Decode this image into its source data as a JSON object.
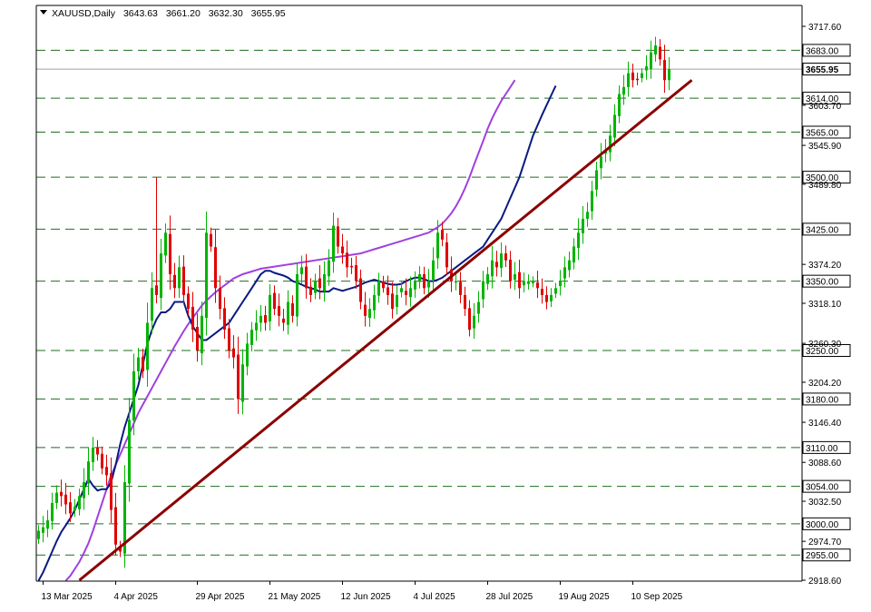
{
  "header": {
    "symbol": "XAUUSD,Daily",
    "open": "3643.63",
    "high": "3661.20",
    "low": "3632.30",
    "close": "3655.95"
  },
  "colors": {
    "bull": "#00b400",
    "bear": "#e00000",
    "level_line": "#1e6e1e",
    "trendline": "#8b0000",
    "ma_fast": "#0a1a80",
    "ma_slow": "#a040e0",
    "current_price_line": "#a0a0a0"
  },
  "chart_data": {
    "type": "candlestick",
    "instrument": "XAUUSD",
    "timeframe": "Daily",
    "ylim": [
      2918.6,
      3717.6
    ],
    "y_ticks": [
      "3717.60",
      "3603.70",
      "3545.90",
      "3489.80",
      "3374.20",
      "3318.10",
      "3260.30",
      "3204.20",
      "3146.40",
      "3088.60",
      "3032.50",
      "2974.70",
      "2918.60"
    ],
    "x_ticks": [
      "13 Mar 2025",
      "4 Apr 2025",
      "29 Apr 2025",
      "21 May 2025",
      "12 Jun 2025",
      "4 Jul 2025",
      "28 Jul 2025",
      "19 Aug 2025",
      "10 Sep 2025"
    ],
    "x_tick_bar_index": [
      1,
      17,
      35,
      51,
      67,
      83,
      99,
      115,
      131
    ],
    "bar_count": 140,
    "horizontal_levels": [
      "3683.00",
      "3614.00",
      "3565.00",
      "3500.00",
      "3425.00",
      "3350.00",
      "3250.00",
      "3180.00",
      "3110.00",
      "3054.00",
      "3000.00",
      "2955.00"
    ],
    "current_price": "3655.95",
    "closes": [
      2990,
      2995,
      3005,
      3030,
      3045,
      3040,
      3028,
      3015,
      3025,
      3040,
      3060,
      3090,
      3110,
      3100,
      3080,
      3070,
      3020,
      2970,
      2960,
      3060,
      3150,
      3220,
      3240,
      3220,
      3290,
      3340,
      3330,
      3390,
      3420,
      3360,
      3340,
      3370,
      3330,
      3310,
      3280,
      3250,
      3300,
      3420,
      3400,
      3340,
      3310,
      3280,
      3250,
      3240,
      3180,
      3230,
      3260,
      3280,
      3290,
      3300,
      3290,
      3330,
      3310,
      3300,
      3290,
      3320,
      3300,
      3360,
      3370,
      3340,
      3330,
      3350,
      3340,
      3360,
      3380,
      3430,
      3400,
      3390,
      3370,
      3370,
      3350,
      3320,
      3300,
      3310,
      3330,
      3350,
      3340,
      3330,
      3310,
      3330,
      3340,
      3330,
      3340,
      3350,
      3360,
      3340,
      3350,
      3380,
      3420,
      3410,
      3370,
      3350,
      3350,
      3330,
      3310,
      3280,
      3300,
      3320,
      3350,
      3360,
      3380,
      3370,
      3390,
      3380,
      3350,
      3360,
      3340,
      3350,
      3350,
      3350,
      3340,
      3330,
      3320,
      3330,
      3340,
      3350,
      3370,
      3380,
      3400,
      3420,
      3440,
      3450,
      3480,
      3510,
      3530,
      3540,
      3560,
      3590,
      3620,
      3630,
      3650,
      3640,
      3640,
      3650,
      3660,
      3680,
      3690,
      3670,
      3640,
      3655.95
    ],
    "ma_fast_start_bar": 0,
    "ma_fast": [
      2918,
      2930,
      2945,
      2960,
      2975,
      2988,
      2998,
      3008,
      3020,
      3035,
      3050,
      3065,
      3055,
      3048,
      3050,
      3050,
      3060,
      3085,
      3115,
      3140,
      3160,
      3180,
      3200,
      3230,
      3260,
      3280,
      3295,
      3305,
      3305,
      3310,
      3320,
      3320,
      3320,
      3300,
      3285,
      3275,
      3265,
      3265,
      3270,
      3275,
      3280,
      3285,
      3290,
      3300,
      3310,
      3320,
      3330,
      3340,
      3350,
      3360,
      3365,
      3365,
      3362,
      3360,
      3358,
      3355,
      3350,
      3348,
      3345,
      3342,
      3340,
      3338,
      3335,
      3335,
      3335,
      3340,
      3338,
      3336,
      3338,
      3340,
      3342,
      3345,
      3348,
      3350,
      3352,
      3350,
      3348,
      3346,
      3345,
      3345,
      3346,
      3350,
      3353,
      3355,
      3355,
      3353,
      3350,
      3350,
      3352,
      3355,
      3360,
      3365,
      3370,
      3375,
      3380,
      3385,
      3390,
      3395,
      3400,
      3410,
      3420,
      3430,
      3440,
      3455,
      3470,
      3485,
      3500,
      3520,
      3540,
      3560,
      3575,
      3590,
      3604,
      3618,
      3632
    ],
    "ma_slow_start_bar": 6,
    "ma_slow": [
      2918,
      2925,
      2935,
      2945,
      2958,
      2972,
      2990,
      3010,
      3030,
      3050,
      3070,
      3085,
      3100,
      3115,
      3130,
      3145,
      3160,
      3172,
      3184,
      3196,
      3208,
      3220,
      3232,
      3244,
      3256,
      3267,
      3278,
      3288,
      3297,
      3306,
      3315,
      3322,
      3328,
      3334,
      3339,
      3344,
      3349,
      3354,
      3357,
      3360,
      3362,
      3364,
      3366,
      3368,
      3369,
      3370,
      3371,
      3372,
      3373,
      3374,
      3375,
      3376,
      3377,
      3378,
      3379,
      3380,
      3381,
      3382,
      3383,
      3384,
      3385,
      3386,
      3387,
      3388,
      3389,
      3390,
      3392,
      3394,
      3396,
      3398,
      3400,
      3402,
      3404,
      3406,
      3408,
      3410,
      3412,
      3414,
      3416,
      3418,
      3420,
      3424,
      3428,
      3433,
      3440,
      3448,
      3458,
      3470,
      3484,
      3500,
      3518,
      3535,
      3552,
      3570,
      3585,
      3598,
      3610,
      3620,
      3630,
      3640
    ],
    "trendline": {
      "from": {
        "bar": 9,
        "price": 2918.6
      },
      "to": {
        "bar": 144,
        "price": 3640
      }
    }
  }
}
